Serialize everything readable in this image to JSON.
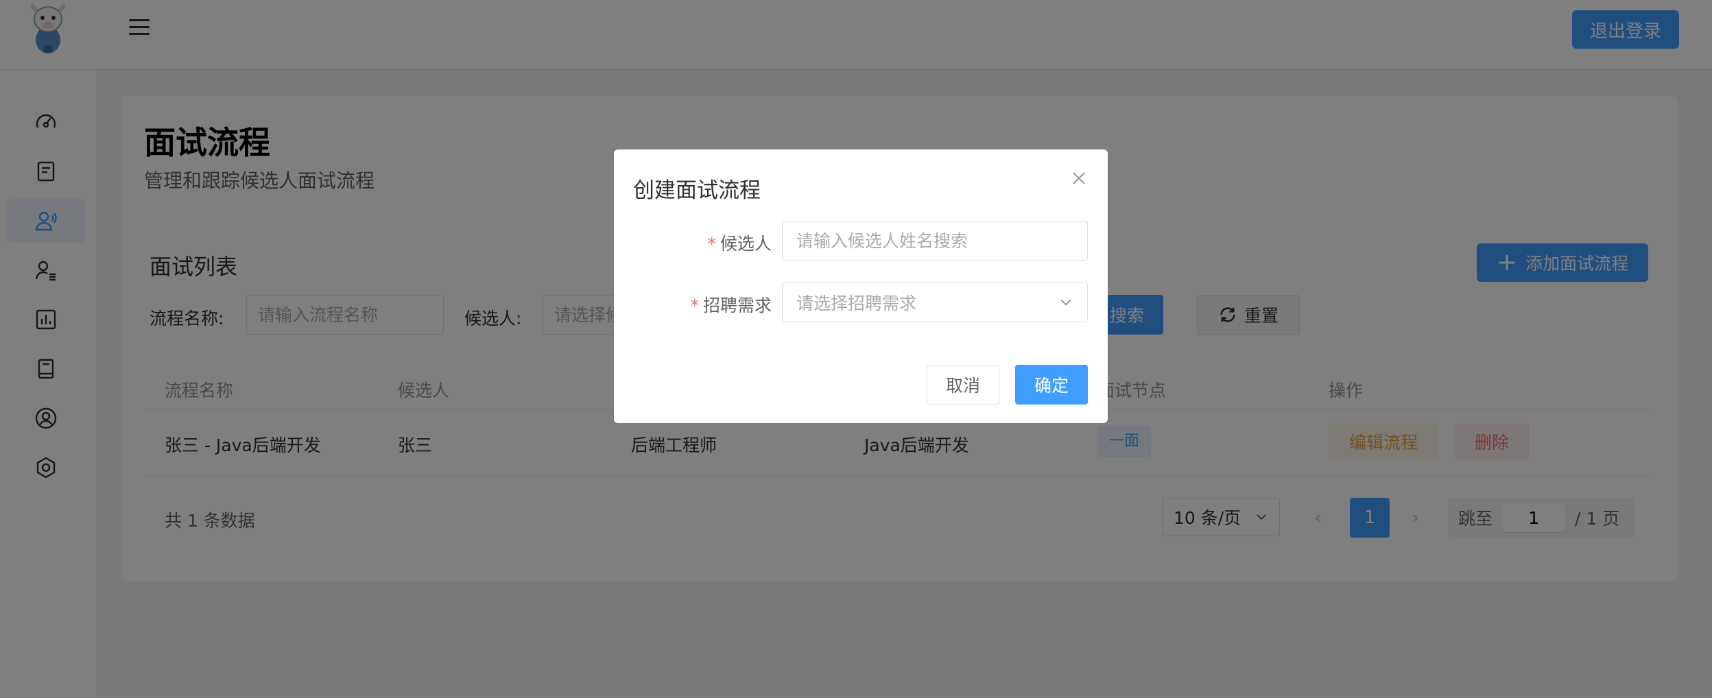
{
  "header": {
    "logo_icon": "cow-mascot-icon",
    "menu_icon": "hamburger-icon",
    "logout_label": "退出登录"
  },
  "sidebar": {
    "items": [
      {
        "icon": "dashboard-gauge-icon",
        "active": false
      },
      {
        "icon": "document-icon",
        "active": false
      },
      {
        "icon": "user-interview-icon",
        "active": true
      },
      {
        "icon": "user-list-icon",
        "active": false
      },
      {
        "icon": "bar-chart-icon",
        "active": false
      },
      {
        "icon": "book-icon",
        "active": false
      },
      {
        "icon": "user-circle-icon",
        "active": false
      },
      {
        "icon": "settings-hexagon-icon",
        "active": false
      }
    ]
  },
  "page": {
    "title": "面试流程",
    "subtitle": "管理和跟踪候选人面试流程"
  },
  "list": {
    "title": "面试列表",
    "add_label": "添加面试流程"
  },
  "filters": {
    "process_name_label": "流程名称:",
    "process_name_placeholder": "请输入流程名称",
    "candidate_label": "候选人:",
    "candidate_placeholder": "请选择候选人",
    "search_label": "搜索",
    "reset_label": "重置"
  },
  "table": {
    "columns": [
      "流程名称",
      "候选人",
      "",
      "",
      "面试节点",
      "操作"
    ],
    "rows": [
      {
        "process_name": "张三 - Java后端开发",
        "candidate": "张三",
        "position": "后端工程师",
        "requirement": "Java后端开发",
        "stage": "一面",
        "edit_label": "编辑流程",
        "delete_label": "删除"
      }
    ]
  },
  "pagination": {
    "total_text": "共 1 条数据",
    "page_size": "10 条/页",
    "current_page": "1",
    "jump_label": "跳至",
    "jump_value": "1",
    "total_pages_text": "/ 1 页"
  },
  "dialog": {
    "title": "创建面试流程",
    "close_icon": "close-icon",
    "required_mark": "*",
    "candidate_label": "候选人",
    "candidate_placeholder": "请输入候选人姓名搜索",
    "requirement_label": "招聘需求",
    "requirement_placeholder": "请选择招聘需求",
    "cancel_label": "取消",
    "confirm_label": "确定"
  },
  "colors": {
    "primary": "#409eff",
    "overlay": "rgba(0,0,0,0.5)",
    "warning": "#e6a23c",
    "danger": "#f56c6c"
  }
}
